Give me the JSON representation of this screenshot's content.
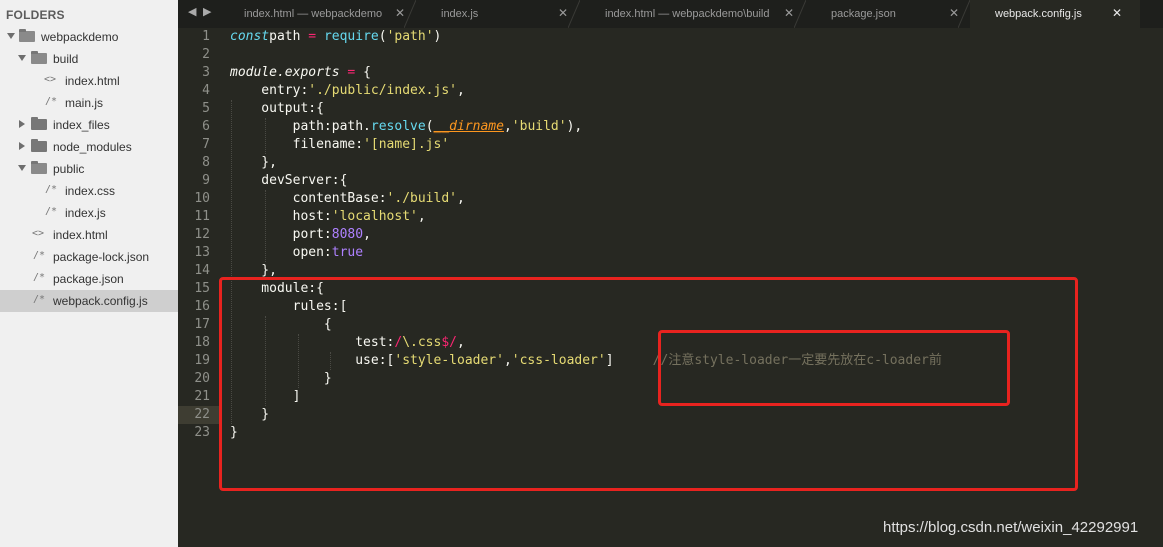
{
  "sidebar": {
    "title": "FOLDERS",
    "items": [
      {
        "label": "webpackdemo"
      },
      {
        "label": "build"
      },
      {
        "label": "index.html",
        "icon": "<>"
      },
      {
        "label": "main.js",
        "icon": "/*"
      },
      {
        "label": "index_files"
      },
      {
        "label": "node_modules"
      },
      {
        "label": "public"
      },
      {
        "label": "index.css",
        "icon": "/*"
      },
      {
        "label": "index.js",
        "icon": "/*"
      },
      {
        "label": "index.html",
        "icon": "<>"
      },
      {
        "label": "package-lock.json",
        "icon": "/*"
      },
      {
        "label": "package.json",
        "icon": "/*"
      },
      {
        "label": "webpack.config.js",
        "icon": "/*"
      }
    ]
  },
  "tabs": [
    {
      "label": "index.html — webpackdemo",
      "close": "✕"
    },
    {
      "label": "index.js",
      "close": "✕"
    },
    {
      "label": "index.html — webpackdemo\\build",
      "close": "✕"
    },
    {
      "label": "package.json",
      "close": "✕"
    },
    {
      "label": "webpack.config.js",
      "close": "✕"
    }
  ],
  "editor": {
    "line_numbers": [
      "1",
      "2",
      "3",
      "4",
      "5",
      "6",
      "7",
      "8",
      "9",
      "10",
      "11",
      "12",
      "13",
      "14",
      "15",
      "16",
      "17",
      "18",
      "19",
      "20",
      "21",
      "22",
      "23"
    ],
    "current_line": "22",
    "code": [
      {
        "s": [
          [
            "kw",
            "const"
          ],
          [
            "",
            "path"
          ],
          [
            "op",
            " = "
          ],
          [
            "fn",
            "require"
          ],
          [
            "",
            "("
          ],
          [
            "str",
            "'path'"
          ],
          [
            "",
            ")"
          ]
        ]
      },
      {
        "s": []
      },
      {
        "s": [
          [
            "i",
            "module"
          ],
          [
            "",
            ""
          ],
          [
            "i",
            ".exports"
          ],
          [
            "op",
            " = "
          ],
          [
            "",
            "{"
          ]
        ]
      },
      {
        "s": [
          [
            "",
            "    entry:"
          ],
          [
            "str",
            "'./public/index.js'"
          ],
          [
            "",
            ","
          ]
        ]
      },
      {
        "s": [
          [
            "",
            "    output:{"
          ]
        ]
      },
      {
        "s": [
          [
            "",
            "        path:path."
          ],
          [
            "fn",
            "resolve"
          ],
          [
            "",
            "("
          ],
          [
            "var",
            "__dirname"
          ],
          [
            "",
            ","
          ],
          [
            "str",
            "'build'"
          ],
          [
            "",
            "),"
          ]
        ]
      },
      {
        "s": [
          [
            "",
            "        filename:"
          ],
          [
            "str",
            "'[name].js'"
          ]
        ]
      },
      {
        "s": [
          [
            "",
            "    },"
          ]
        ]
      },
      {
        "s": [
          [
            "",
            "    devServer:{"
          ]
        ]
      },
      {
        "s": [
          [
            "",
            "        contentBase:"
          ],
          [
            "str",
            "'./build'"
          ],
          [
            "",
            ","
          ]
        ]
      },
      {
        "s": [
          [
            "",
            "        host:"
          ],
          [
            "str",
            "'localhost'"
          ],
          [
            "",
            ","
          ]
        ]
      },
      {
        "s": [
          [
            "",
            "        port:"
          ],
          [
            "num",
            "8080"
          ],
          [
            "",
            ","
          ]
        ]
      },
      {
        "s": [
          [
            "",
            "        open:"
          ],
          [
            "num",
            "true"
          ]
        ]
      },
      {
        "s": [
          [
            "",
            "    },"
          ]
        ]
      },
      {
        "s": [
          [
            "",
            "    module:{"
          ]
        ]
      },
      {
        "s": [
          [
            "",
            "        rules:["
          ]
        ]
      },
      {
        "s": [
          [
            "",
            "            {"
          ]
        ]
      },
      {
        "s": [
          [
            "",
            "                test:"
          ],
          [
            "op",
            "/"
          ],
          [
            "str",
            "\\.css"
          ],
          [
            "op",
            "$/"
          ],
          [
            "",
            ","
          ]
        ]
      },
      {
        "s": [
          [
            "",
            "                use:["
          ],
          [
            "str",
            "'style-loader'"
          ],
          [
            "",
            ","
          ],
          [
            "str",
            "'css-loader'"
          ],
          [
            "",
            "]     "
          ],
          [
            "cmt",
            "//注意style-loader一定要先放在c-loader前"
          ]
        ]
      },
      {
        "s": [
          [
            "",
            "            }"
          ]
        ]
      },
      {
        "s": [
          [
            "",
            "        ]"
          ]
        ]
      },
      {
        "s": [
          [
            "",
            "    }"
          ]
        ]
      },
      {
        "s": [
          [
            "",
            "}"
          ]
        ]
      }
    ]
  },
  "colors": {
    "highlight_box": "#e8231f",
    "editor_bg": "#272822",
    "sidebar_bg": "#f0f0f0"
  },
  "watermark": "https://blog.csdn.net/weixin_42292991"
}
